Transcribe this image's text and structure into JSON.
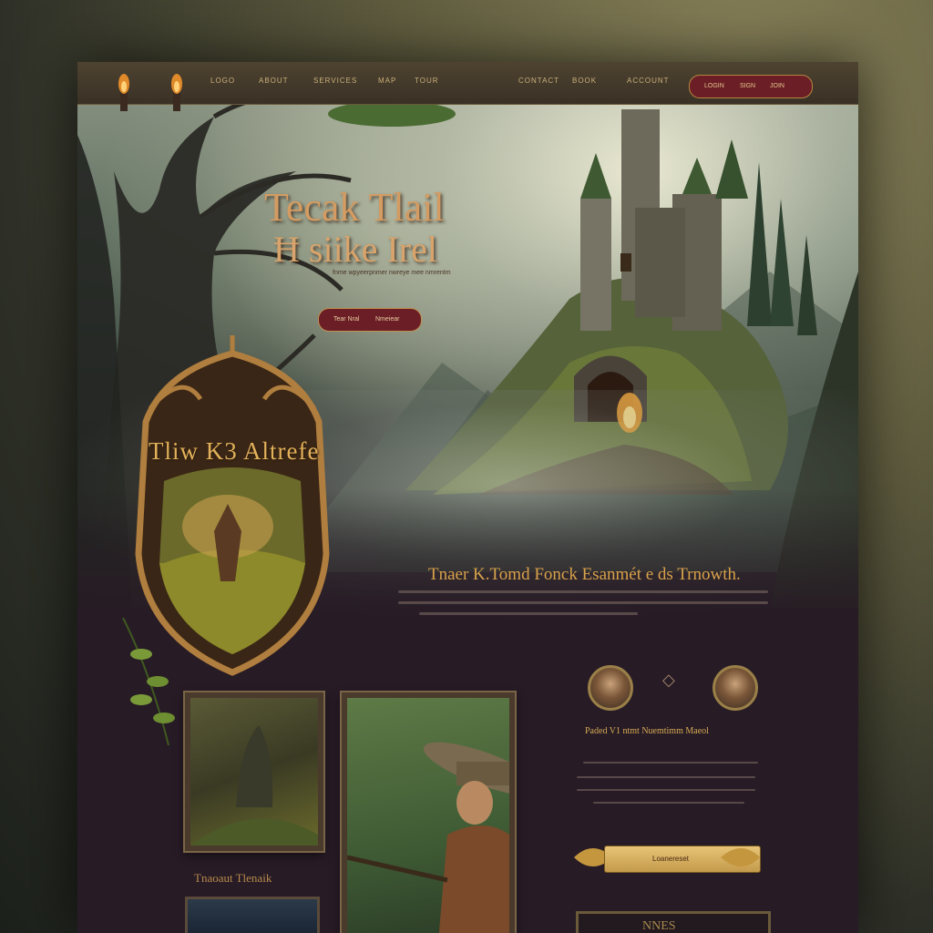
{
  "nav": {
    "items": [
      "LOGO",
      "ABOUT",
      "SERVICES",
      "MAP",
      "TOUR",
      "CONTACT",
      "BOOK",
      "ACCOUNT"
    ],
    "cta_items": [
      "LOGIN",
      "SIGN",
      "JOIN"
    ]
  },
  "hero": {
    "title_line1": "Tecak Tlail",
    "title_line2": "Ħ siike Irel",
    "subtitle": "fnme wpyeerpnmer nwreye mee nmrentm",
    "button_left": "Tear Nral",
    "button_right": "Nmeiear"
  },
  "shield": {
    "title": "Tliw K3 Altrefe"
  },
  "section": {
    "title": "Tnaer K.Tomd Fonck Esanmét e ds Trnowth."
  },
  "gallery": {
    "caption": "Tnaoaut Tlenaik"
  },
  "testimonial": {
    "title": "Paded V1 ntmt Nuemtimm Maeol"
  },
  "banner": {
    "label": "Loanereset"
  },
  "footer_box": {
    "label": "NNES"
  },
  "colors": {
    "accent": "#d49c62",
    "button": "#6b1e26",
    "gold": "#d8a24a",
    "page_bg": "#271b25"
  },
  "icons": [
    "torch-icon",
    "leaf-icon",
    "diamond-icon"
  ]
}
